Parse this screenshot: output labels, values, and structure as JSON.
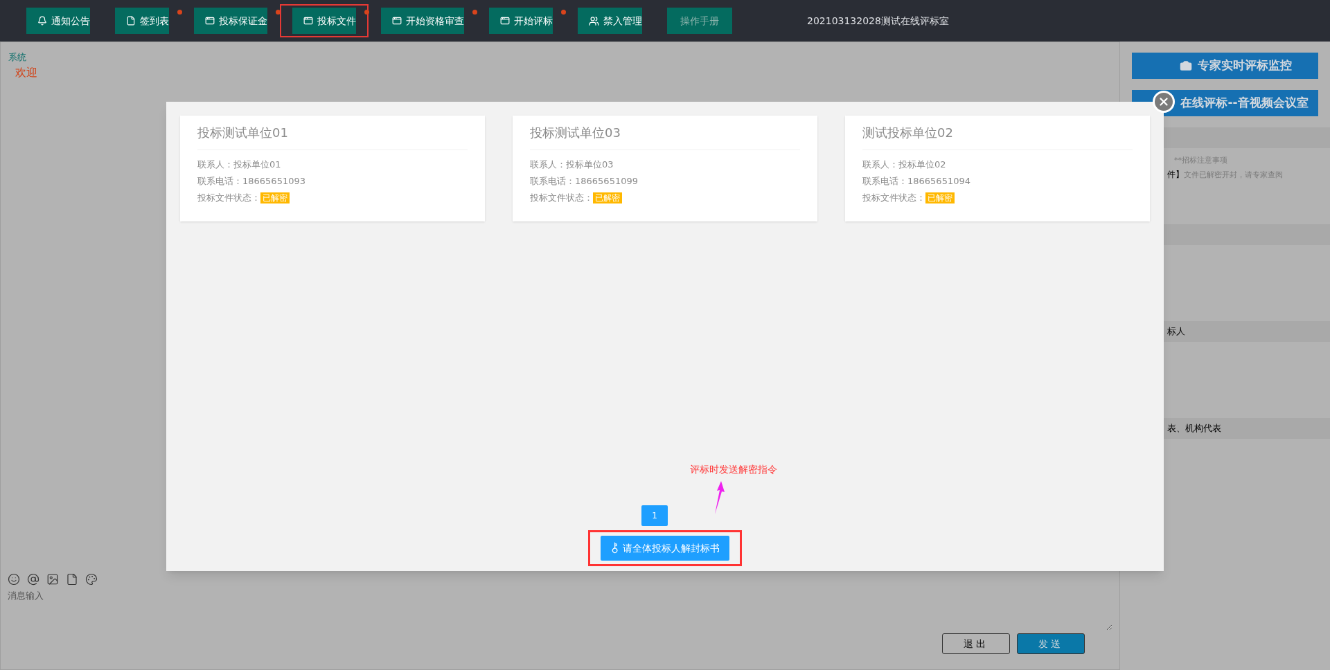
{
  "toolbar": {
    "buttons": [
      {
        "label": "通知公告",
        "dot": false,
        "highlighted": false,
        "disabled": false
      },
      {
        "label": "签到表",
        "dot": true,
        "highlighted": false,
        "disabled": false
      },
      {
        "label": "投标保证金",
        "dot": true,
        "highlighted": false,
        "disabled": false
      },
      {
        "label": "投标文件",
        "dot": true,
        "highlighted": true,
        "disabled": false
      },
      {
        "label": "开始资格审查",
        "dot": true,
        "highlighted": false,
        "disabled": false
      },
      {
        "label": "开始评标",
        "dot": true,
        "highlighted": false,
        "disabled": false
      },
      {
        "label": "禁入管理",
        "dot": false,
        "highlighted": false,
        "disabled": false
      },
      {
        "label": "操作手册",
        "dot": false,
        "highlighted": false,
        "disabled": true
      }
    ],
    "title": "202103132028测试在线评标室"
  },
  "chat": {
    "messages": [
      {
        "sender": "系统",
        "text": "欢迎"
      }
    ],
    "input": {
      "placeholder": "消息输入"
    },
    "buttons": [
      {
        "label": "退出",
        "kind": "secondary"
      },
      {
        "label": "发送",
        "kind": "primary"
      }
    ]
  },
  "sidebar": {
    "buttons": [
      {
        "label": "专家实时评标监控"
      },
      {
        "label": "在线评标--音视频会议室"
      }
    ],
    "sections": [
      {
        "lines": [
          {
            "text": "**招标注意事项"
          },
          {
            "bold": "件】",
            "text": "文件已解密开封，请专家查阅"
          }
        ]
      },
      {
        "header": "标人"
      },
      {
        "header": "表、机构代表"
      }
    ]
  },
  "modal": {
    "cards": [
      {
        "title": "投标测试单位01",
        "contact_label": "联系人：",
        "contact": "投标单位01",
        "phone_label": "联系电话：",
        "phone": "18665651093",
        "status_label": "投标文件状态：",
        "status": "已解密"
      },
      {
        "title": "投标测试单位03",
        "contact_label": "联系人：",
        "contact": "投标单位03",
        "phone_label": "联系电话：",
        "phone": "18665651099",
        "status_label": "投标文件状态：",
        "status": "已解密"
      },
      {
        "title": "测试投标单位02",
        "contact_label": "联系人：",
        "contact": "投标单位02",
        "phone_label": "联系电话：",
        "phone": "18665651094",
        "status_label": "投标文件状态：",
        "status": "已解密"
      }
    ],
    "pages": [
      {
        "label": "1",
        "selected": true
      }
    ],
    "annotation": "评标时发送解密指令",
    "action": {
      "label": "请全体投标人解封标书",
      "highlighted": true
    }
  }
}
